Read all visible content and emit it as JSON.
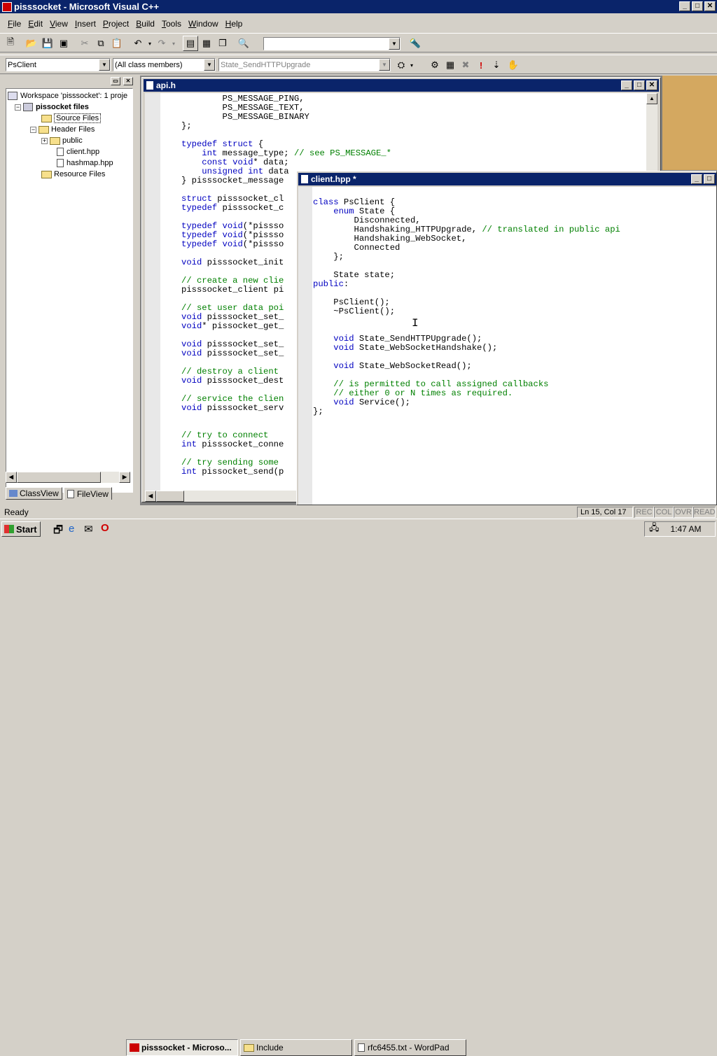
{
  "app": {
    "title": "pisssocket - Microsoft Visual C++",
    "min": "_",
    "max": "□",
    "close": "✕"
  },
  "menu": [
    "File",
    "Edit",
    "View",
    "Insert",
    "Project",
    "Build",
    "Tools",
    "Window",
    "Help"
  ],
  "toolbar2": {
    "class_combo": "PsClient",
    "members_combo": "(All class members)",
    "function_combo": "State_SendHTTPUpgrade"
  },
  "workspace": {
    "title": "Workspace 'pisssocket': 1 proje",
    "project": "pissocket files",
    "items": [
      "Source Files",
      "Header Files",
      "public",
      "client.hpp",
      "hashmap.hpp",
      "Resource Files"
    ],
    "tabs": [
      "ClassView",
      "FileView"
    ]
  },
  "api_window": {
    "title": "api.h",
    "lines": [
      [
        [
          "        PS_MESSAGE_PING,",
          ""
        ]
      ],
      [
        [
          "        PS_MESSAGE_TEXT,",
          ""
        ]
      ],
      [
        [
          "        PS_MESSAGE_BINARY",
          ""
        ]
      ],
      [
        [
          "};",
          ""
        ]
      ],
      [
        [
          "",
          ""
        ]
      ],
      [
        [
          "typedef struct",
          "kw"
        ],
        [
          " {",
          ""
        ]
      ],
      [
        [
          "    ",
          ""
        ],
        [
          "int",
          "kw"
        ],
        [
          " message_type; ",
          ""
        ],
        [
          "// see PS_MESSAGE_*",
          "cm"
        ]
      ],
      [
        [
          "    ",
          ""
        ],
        [
          "const void",
          "kw"
        ],
        [
          "* data;",
          ""
        ]
      ],
      [
        [
          "    ",
          ""
        ],
        [
          "unsigned int",
          "kw"
        ],
        [
          " data",
          ""
        ]
      ],
      [
        [
          "} pisssocket_message",
          ""
        ]
      ],
      [
        [
          "",
          ""
        ]
      ],
      [
        [
          "struct",
          "kw"
        ],
        [
          " pisssocket_cl",
          ""
        ]
      ],
      [
        [
          "typedef",
          "kw"
        ],
        [
          " pisssocket_c",
          ""
        ]
      ],
      [
        [
          "",
          ""
        ]
      ],
      [
        [
          "typedef void",
          "kw"
        ],
        [
          "(*pissso",
          ""
        ]
      ],
      [
        [
          "typedef void",
          "kw"
        ],
        [
          "(*pissso",
          ""
        ]
      ],
      [
        [
          "typedef void",
          "kw"
        ],
        [
          "(*pissso",
          ""
        ]
      ],
      [
        [
          "",
          ""
        ]
      ],
      [
        [
          "void",
          "kw"
        ],
        [
          " pisssocket_init",
          ""
        ]
      ],
      [
        [
          "",
          ""
        ]
      ],
      [
        [
          "// create a new clie",
          "cm"
        ]
      ],
      [
        [
          "pisssocket_client pi",
          ""
        ]
      ],
      [
        [
          "",
          ""
        ]
      ],
      [
        [
          "// set user data poi",
          "cm"
        ]
      ],
      [
        [
          "void",
          "kw"
        ],
        [
          " pisssocket_set_",
          ""
        ]
      ],
      [
        [
          "void",
          "kw"
        ],
        [
          "* pissocket_get_",
          ""
        ]
      ],
      [
        [
          "",
          ""
        ]
      ],
      [
        [
          "void",
          "kw"
        ],
        [
          " pisssocket_set_",
          ""
        ]
      ],
      [
        [
          "void",
          "kw"
        ],
        [
          " pisssocket_set_",
          ""
        ]
      ],
      [
        [
          "",
          ""
        ]
      ],
      [
        [
          "// destroy a client",
          "cm"
        ]
      ],
      [
        [
          "void",
          "kw"
        ],
        [
          " pisssocket_dest",
          ""
        ]
      ],
      [
        [
          "",
          ""
        ]
      ],
      [
        [
          "// service the clien",
          "cm"
        ]
      ],
      [
        [
          "void",
          "kw"
        ],
        [
          " pisssocket_serv",
          ""
        ]
      ],
      [
        [
          "",
          ""
        ]
      ],
      [
        [
          "",
          ""
        ]
      ],
      [
        [
          "// try to connect",
          "cm"
        ]
      ],
      [
        [
          "int",
          "kw"
        ],
        [
          " pisssocket_conne",
          ""
        ]
      ],
      [
        [
          "",
          ""
        ]
      ],
      [
        [
          "// try sending some ",
          "cm"
        ]
      ],
      [
        [
          "int",
          "kw"
        ],
        [
          " pissocket_send(p",
          ""
        ]
      ]
    ]
  },
  "client_window": {
    "title": "client.hpp *",
    "lines": [
      [
        [
          "",
          ""
        ]
      ],
      [
        [
          "class",
          "kw"
        ],
        [
          " PsClient {",
          ""
        ]
      ],
      [
        [
          "    ",
          ""
        ],
        [
          "enum",
          "kw"
        ],
        [
          " State {",
          ""
        ]
      ],
      [
        [
          "        Disconnected,",
          ""
        ]
      ],
      [
        [
          "        Handshaking_HTTPUpgrade, ",
          ""
        ],
        [
          "// translated in public api",
          "cm"
        ]
      ],
      [
        [
          "        Handshaking_WebSocket,",
          ""
        ]
      ],
      [
        [
          "        Connected",
          ""
        ]
      ],
      [
        [
          "    };",
          ""
        ]
      ],
      [
        [
          "",
          ""
        ]
      ],
      [
        [
          "    State state;",
          ""
        ]
      ],
      [
        [
          "public",
          "kw"
        ],
        [
          ":",
          ""
        ]
      ],
      [
        [
          "",
          ""
        ]
      ],
      [
        [
          "    PsClient();",
          ""
        ]
      ],
      [
        [
          "    ~PsClient();",
          ""
        ]
      ],
      [
        [
          "",
          ""
        ]
      ],
      [
        [
          "",
          ""
        ]
      ],
      [
        [
          "    ",
          ""
        ],
        [
          "void",
          "kw"
        ],
        [
          " State_SendHTTPUpgrade();",
          ""
        ]
      ],
      [
        [
          "    ",
          ""
        ],
        [
          "void",
          "kw"
        ],
        [
          " State_WebSocketHandshake();",
          ""
        ]
      ],
      [
        [
          "",
          ""
        ]
      ],
      [
        [
          "    ",
          ""
        ],
        [
          "void",
          "kw"
        ],
        [
          " State_WebSocketRead();",
          ""
        ]
      ],
      [
        [
          "",
          ""
        ]
      ],
      [
        [
          "    ",
          ""
        ],
        [
          "// is permitted to call assigned callbacks",
          "cm"
        ]
      ],
      [
        [
          "    ",
          ""
        ],
        [
          "// either 0 or N times as required.",
          "cm"
        ]
      ],
      [
        [
          "    ",
          ""
        ],
        [
          "void",
          "kw"
        ],
        [
          " Service();",
          ""
        ]
      ],
      [
        [
          "};",
          ""
        ]
      ]
    ]
  },
  "status": {
    "ready": "Ready",
    "position": "Ln 15, Col 17",
    "rec": "REC",
    "col": "COL",
    "ovr": "OVR",
    "read": "READ"
  },
  "taskbar": {
    "start": "Start",
    "tasks": [
      "pisssocket - Microso...",
      "Include",
      "rfc6455.txt - WordPad"
    ],
    "clock": "1:47 AM"
  },
  "colors": {
    "keyword": "#0000c0",
    "comment": "#008000",
    "titlebar": "#0a246a"
  }
}
